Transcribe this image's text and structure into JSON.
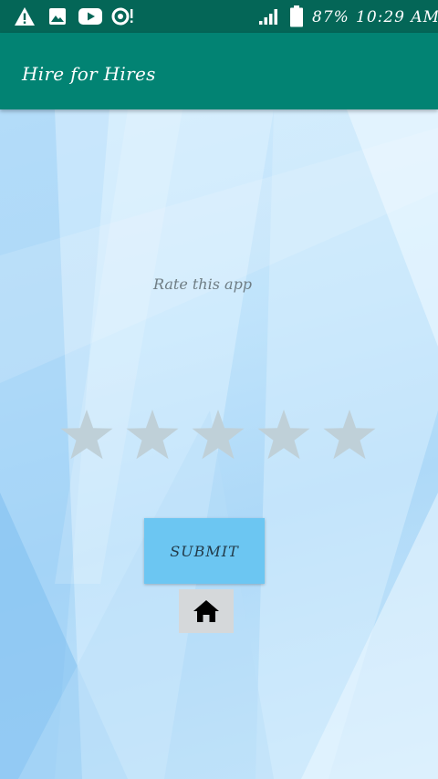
{
  "status_bar": {
    "icons": [
      "warning-icon",
      "image-icon",
      "youtube-icon",
      "sync-notification-icon",
      "signal-icon",
      "battery-icon"
    ],
    "battery": "87%",
    "time": "10:29 AM"
  },
  "app_bar": {
    "title": "Hire for Hires"
  },
  "rating": {
    "label": "Rate this app",
    "max": 5,
    "value": 0,
    "empty_color": "#bfd0d8"
  },
  "actions": {
    "submit_label": "SUBMIT",
    "home_icon": "home-icon"
  },
  "colors": {
    "status_bar": "#046657",
    "app_bar": "#028373",
    "submit_bg": "#6cc6f2",
    "home_bg": "#d5d8da"
  }
}
